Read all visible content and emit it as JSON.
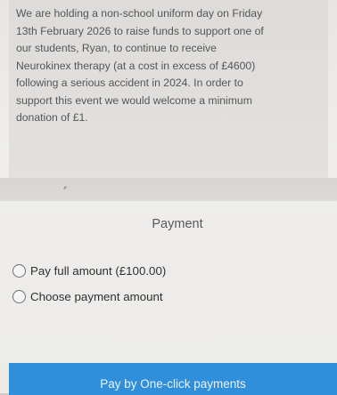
{
  "info": {
    "text": "We are holding a non-school uniform day on Friday\n13th February 2026 to raise funds to support one of\nour students, Ryan, to continue to receive\nNeurokinex therapy (at a cost in excess of £4600)\nfollowing a serious accident in 2024. In order to\nsupport this event we would welcome a minimum\ndonation of £1."
  },
  "payment": {
    "heading": "Payment",
    "options": [
      {
        "label": "Pay full amount (£100.00)",
        "selected": false
      },
      {
        "label": "Choose payment amount",
        "selected": false
      }
    ],
    "button_label": "Pay by One-click payments"
  },
  "colors": {
    "button_bg": "#2f8fda",
    "button_text": "#eaf3fb"
  }
}
